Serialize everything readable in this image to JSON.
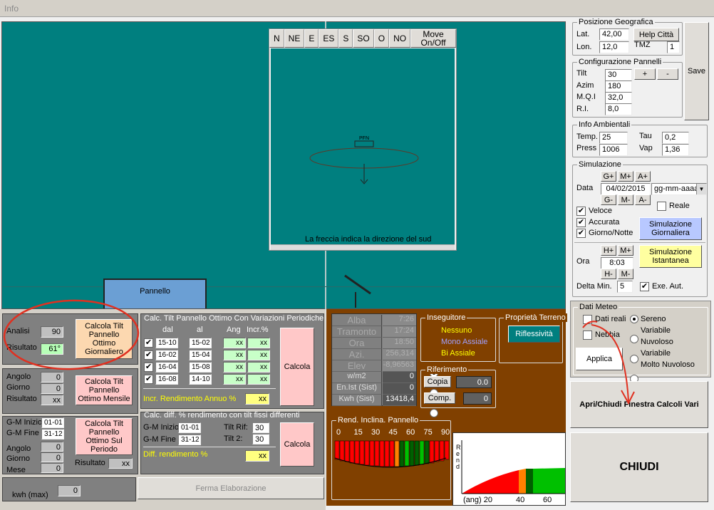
{
  "menu": {
    "info": "Info"
  },
  "compass": {
    "buttons": [
      "N",
      "NE",
      "E",
      "ES",
      "S",
      "SO",
      "O",
      "NO",
      "Move On/Off"
    ],
    "panel_tag": "PFN",
    "caption": "La freccia indica la direzione del  sud"
  },
  "pannello_label": "Pannello",
  "posizione": {
    "title": "Posizione Geografica",
    "lat_label": "Lat.",
    "lat": "42,00",
    "lon_label": "Lon.",
    "lon": "12,0",
    "help": "Help Città",
    "tmz_label": "TMZ",
    "tmz": "1",
    "save": "Save"
  },
  "config": {
    "title": "Configurazione Pannelli",
    "tilt_label": "Tilt",
    "tilt": "30",
    "azim_label": "Azim",
    "azim": "180",
    "mqi_label": "M.Q.I",
    "mqi": "32,0",
    "ri_label": "R.I.",
    "ri": "8,0",
    "plus": "+",
    "minus": "-"
  },
  "ambient": {
    "title": "Info Ambientali",
    "temp_label": "Temp.",
    "temp": "25",
    "press_label": "Press",
    "press": "1006",
    "tau_label": "Tau",
    "tau": "0,2",
    "vap_label": "Vap",
    "vap": "1,36"
  },
  "simulazione": {
    "title": "Simulazione",
    "gplus": "G+",
    "mplus": "M+",
    "aplus": "A+",
    "gminus": "G-",
    "mminus": "M-",
    "aminus": "A-",
    "data_label": "Data",
    "data": "04/02/2015",
    "format": "gg-mm-aaaa",
    "reale": "Reale",
    "veloce": "Veloce",
    "accurata": "Accurata",
    "giorno_notte": "Giorno/Notte",
    "sim_giornaliera": "Simulazione Giornaliera",
    "hplus": "H+",
    "hmplus": "M+",
    "hminus": "H-",
    "hmminus": "M-",
    "ora_label": "Ora",
    "ora": "8:03",
    "sim_istantanea": "Simulazione Istantanea",
    "delta_label": "Delta Min.",
    "delta": "5",
    "exe_aut": "Exe. Aut."
  },
  "meteo": {
    "title": "Dati Meteo",
    "dati_reali": "Dati reali",
    "nebbia": "Nebbia",
    "applica": "Applica",
    "options": [
      "Sereno",
      "Variabile",
      "Nuvoloso",
      "Variabile",
      "Molto Nuvoloso"
    ]
  },
  "apri_chiudi": "Apri/Chiudi  Finestra Calcoli Vari",
  "chiudi": "CHIUDI",
  "box1": {
    "analisi_label": "Analisi",
    "analisi": "90",
    "risultato_label": "Risultato",
    "risultato": "61°",
    "button": "Calcola Tilt Pannello Ottimo Giornaliero"
  },
  "box2": {
    "angolo_label": "Angolo",
    "angolo": "0",
    "giorno_label": "Giorno",
    "giorno": "0",
    "risultato_label": "Risultato",
    "risultato": "xx",
    "button": "Calcola Tilt Pannello Ottimo Mensile"
  },
  "box3": {
    "gm_inizio_label": "G-M Inizio",
    "gm_inizio": "01-01",
    "gm_fine_label": "G-M Fine",
    "gm_fine": "31-12",
    "angolo_label": "Angolo",
    "angolo": "0",
    "giorno_label": "Giorno",
    "giorno": "0",
    "mese_label": "Mese",
    "mese": "0",
    "risultato_label": "Risultato",
    "risultato": "xx",
    "button": "Calcola Tilt Pannello Ottimo Sul Periodo"
  },
  "kwh": {
    "label": "kwh (max)",
    "value": "0"
  },
  "ferma": "Ferma Elaborazione",
  "periodiche": {
    "title": "Calc. Tilt Pannello Ottimo Con Variazioni Periodiche",
    "dal": "dal",
    "al": "al",
    "ang": "Ang",
    "incr": "Incr.%",
    "rows": [
      {
        "dal": "15-10",
        "al": "15-02",
        "ang": "xx",
        "incr": "xx"
      },
      {
        "dal": "16-02",
        "al": "15-04",
        "ang": "xx",
        "incr": "xx"
      },
      {
        "dal": "16-04",
        "al": "15-08",
        "ang": "xx",
        "incr": "xx"
      },
      {
        "dal": "16-08",
        "al": "14-10",
        "ang": "xx",
        "incr": "xx"
      }
    ],
    "calcola": "Calcola",
    "incr_label": "Incr. Rendimento Annuo %",
    "incr_value": "xx"
  },
  "diff": {
    "title": "Calc. diff. % rendimento con tilt fissi differenti",
    "gm_inizio_label": "G-M Inizio",
    "gm_inizio": "01-01",
    "gm_fine_label": "G-M Fine",
    "gm_fine": "31-12",
    "tilt_rif_label": "Tilt Rif:",
    "tilt_rif": "30",
    "tilt2_label": "Tilt 2:",
    "tilt2": "30",
    "calcola": "Calcola",
    "diff_label": "Diff. rendimento %",
    "diff_value": "xx"
  },
  "sun": {
    "rows": [
      {
        "label": "Alba",
        "value": "7:26"
      },
      {
        "label": "Tramonto",
        "value": "17:24"
      },
      {
        "label": "Ora",
        "value": "18:50"
      },
      {
        "label": "Azi.",
        "value": "256,314"
      },
      {
        "label": "Elev",
        "value": "-8,96563"
      },
      {
        "label": "w/m2",
        "value": "0"
      },
      {
        "label": "En.Ist (Sist)",
        "value": "0"
      },
      {
        "label": "Kwh (Sist)",
        "value": "13418,4"
      }
    ]
  },
  "inseguitore": {
    "title": "Inseguitore",
    "options": [
      "Nessuno",
      "Mono Assiale",
      "Bi Assiale"
    ]
  },
  "terreno": {
    "title": "Proprietà Terreno",
    "button": "Riflessività"
  },
  "riferimento": {
    "title": "Riferimento",
    "copia": "Copia",
    "copia_val": "0.0",
    "comp": "Comp.",
    "comp_val": "0"
  },
  "rend": {
    "title": "Rend. Inclina. Pannello",
    "ticks": [
      "0",
      "15",
      "30",
      "45",
      "60",
      "75",
      "90"
    ]
  },
  "mini_chart": {
    "ylabel": "Rend",
    "xlabel": "(ang) 20",
    "ticks": [
      "40",
      "60"
    ]
  },
  "colors": {
    "teal": "#007f7f",
    "brown": "#804000",
    "red": "#ff0000",
    "green": "#00c000",
    "orange": "#ff8000",
    "annotation": "#e03020"
  }
}
